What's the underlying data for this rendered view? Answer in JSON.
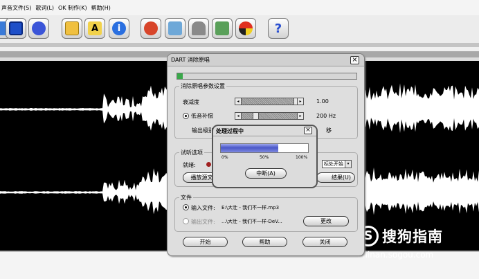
{
  "menu": [
    "声音文件(S)",
    "歌词(L)",
    "OK 制作(K)",
    "帮助(H)"
  ],
  "toolbar": {
    "icons": [
      "open-folder-icon",
      "save-disk-icon",
      "music-tools-icon",
      "folder-open-icon",
      "text-a-icon",
      "info-icon",
      "lips-icon",
      "paint-icon",
      "microphone-icon",
      "notepad-icon",
      "cd-disc-icon",
      "help-icon"
    ],
    "help_glyph": "?",
    "info_glyph": "i"
  },
  "dialog": {
    "title": "DART 消除原唱",
    "close": "×",
    "params_group": "消除原唱参数设置",
    "attenuation_label": "衰减度",
    "attenuation_value": "1.00",
    "attenuation_fraction": 0.97,
    "bass_label": "低音补偿",
    "bass_value": "200 Hz",
    "bass_fraction": 0.22,
    "output_label": "输出级别",
    "output_suffix": "移",
    "listen_group": "试听选项",
    "ready_label": "就绪:",
    "start_select": "标处开始",
    "play_button": "播放源文件",
    "result_button": "结果(U)",
    "file_group": "文件",
    "input_label": "输入文件:",
    "input_value": "E:\\大壮 - 我们不一样.mp3",
    "output_file_label": "输出文件:",
    "output_file_value": "...\\大壮 - 我们不一样-DeV...",
    "change_button": "更改",
    "start_button": "开始",
    "help_button": "帮助",
    "close_button": "关闭"
  },
  "progress": {
    "title": "处理过程中",
    "close": "×",
    "fraction": 0.66,
    "ticks": [
      "0%",
      "50%",
      "100%"
    ],
    "abort_button": "中断(A)"
  },
  "watermark": {
    "brand": "搜狗指南",
    "url": "zhinan.sogou.com"
  },
  "colors": {
    "progress": "#4a57c8",
    "help": "#2a4fd0"
  }
}
